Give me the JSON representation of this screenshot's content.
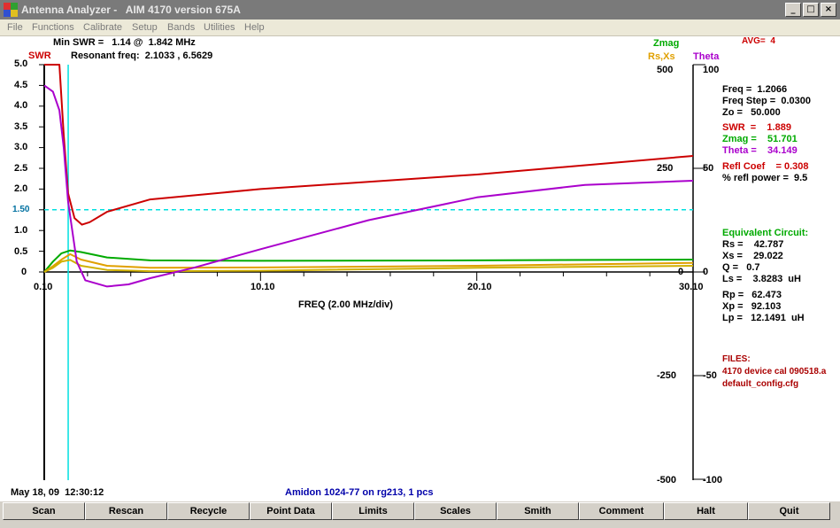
{
  "window": {
    "title": "Antenna Analyzer -   AIM 4170 version 675A",
    "minimize": "_",
    "maximize": "□",
    "close": "×"
  },
  "menu": [
    "File",
    "Functions",
    "Calibrate",
    "Setup",
    "Bands",
    "Utilities",
    "Help"
  ],
  "header": {
    "min_swr": "Min SWR =   1.14 @  1.842 MHz",
    "resonant": "Resonant freq:  2.1033 , 6.5629",
    "zmag": "Zmag",
    "avg": "AVG=  4",
    "rsxs": "Rs,Xs",
    "theta": "Theta",
    "swr": "SWR"
  },
  "axes": {
    "swr_ticks": [
      "5.0",
      "4.5",
      "4.0",
      "3.5",
      "3.0",
      "2.5",
      "2.0",
      "1.50",
      "1.0",
      "0.5",
      "0"
    ],
    "impedance_ticks": [
      "500",
      "250",
      "0",
      "-250",
      "-500"
    ],
    "theta_ticks": [
      "100",
      "50",
      "0",
      "-50",
      "-100"
    ],
    "freq_ticks": [
      "0.10",
      "10.10",
      "20.10",
      "30.10"
    ],
    "freq_label": "FREQ (2.00 MHz/div)",
    "swr_marker": "1.50"
  },
  "readout": {
    "freq": "Freq =  1.2066",
    "freq_step": "Freq Step =  0.0300",
    "zo": "Zo =   50.000",
    "swr": "SWR  =    1.889",
    "zmag": "Zmag =    51.701",
    "theta": "Theta =    34.149",
    "refl_coef": "Refl Coef    = 0.308",
    "refl_power": "% refl power =  9.5",
    "eq_title": "Equivalent Circuit:",
    "rs": "Rs =    42.787",
    "xs": "Xs =    29.022",
    "q": "Q =   0.7",
    "ls": "Ls =    3.8283  uH",
    "rp": "Rp =   62.473",
    "xp": "Xp =   92.103",
    "lp": "Lp =   12.1491  uH",
    "files_title": "FILES:",
    "file1": "4170 device cal 090518.a",
    "file2": "default_config.cfg"
  },
  "footer": {
    "datetime": "May 18, 09  12:30:12",
    "description": "Amidon 1024-77 on rg213, 1 pcs"
  },
  "buttons": [
    "Scan",
    "Rescan",
    "Recycle",
    "Point Data",
    "Limits",
    "Scales",
    "Smith",
    "Comment",
    "Halt",
    "Quit"
  ],
  "colors": {
    "swr": "#cc0000",
    "zmag": "#00aa00",
    "rsxs": "#e0a000",
    "theta": "#aa00cc",
    "readout_blue": "#0000aa",
    "marker_cyan": "#00e0e0"
  },
  "chart_data": {
    "type": "line",
    "xlabel": "FREQ (2.00 MHz/div)",
    "xlim": [
      0.1,
      30.1
    ],
    "y_left": {
      "label": "SWR",
      "ylim": [
        0,
        5.0
      ]
    },
    "y_right_impedance": {
      "label": "Zmag / Rs,Xs",
      "ylim": [
        -500,
        500
      ]
    },
    "y_right_theta": {
      "label": "Theta",
      "ylim": [
        -100,
        100
      ]
    },
    "swr_reference": 1.5,
    "cursor_freq": 1.2066,
    "series": [
      {
        "name": "SWR",
        "axis": "swr",
        "x": [
          0.1,
          0.5,
          0.8,
          1.0,
          1.2,
          1.5,
          1.842,
          2.2,
          3.0,
          5.0,
          10.1,
          20.1,
          30.1
        ],
        "values": [
          5.0,
          5.0,
          5.0,
          3.3,
          1.9,
          1.3,
          1.14,
          1.2,
          1.45,
          1.75,
          2.0,
          2.35,
          2.8
        ]
      },
      {
        "name": "Zmag",
        "axis": "impedance",
        "x": [
          0.1,
          0.5,
          0.9,
          1.3,
          1.8,
          3.0,
          5.0,
          10.1,
          20.1,
          30.1
        ],
        "values": [
          0,
          25,
          45,
          52,
          48,
          35,
          28,
          27,
          28,
          30
        ]
      },
      {
        "name": "Rs",
        "axis": "impedance",
        "x": [
          0.1,
          0.5,
          0.9,
          1.3,
          1.8,
          3.0,
          5.0,
          10.1,
          20.1,
          30.1
        ],
        "values": [
          0,
          14,
          30,
          43,
          30,
          15,
          10,
          11,
          15,
          22
        ]
      },
      {
        "name": "Xs",
        "axis": "impedance",
        "x": [
          0.1,
          0.5,
          0.9,
          1.3,
          1.8,
          3.0,
          5.0,
          10.1,
          20.1,
          30.1
        ],
        "values": [
          0,
          10,
          25,
          29,
          15,
          5,
          2,
          3,
          10,
          15
        ]
      },
      {
        "name": "Theta",
        "axis": "theta",
        "x": [
          0.1,
          0.5,
          0.8,
          1.0,
          1.2,
          1.6,
          2.0,
          3.0,
          4.0,
          5.0,
          7.0,
          10.1,
          15.1,
          20.1,
          25.1,
          30.1
        ],
        "values": [
          90,
          87,
          78,
          60,
          34,
          5,
          -4,
          -7,
          -6,
          -3,
          2,
          11,
          25,
          36,
          42,
          44
        ]
      }
    ]
  }
}
